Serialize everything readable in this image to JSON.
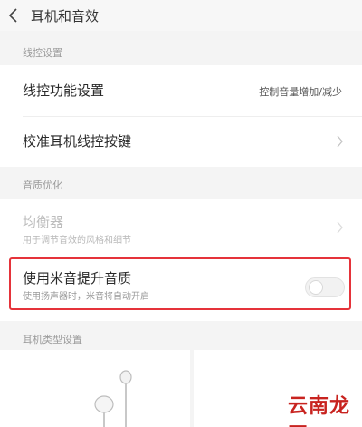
{
  "header": {
    "title": "耳机和音效"
  },
  "wire_control": {
    "section_label": "线控设置",
    "function_setting": {
      "title": "线控功能设置",
      "value": "控制音量增加/减少"
    },
    "calibrate": {
      "title": "校准耳机线控按键"
    }
  },
  "sound_quality": {
    "section_label": "音质优化",
    "equalizer": {
      "title": "均衡器",
      "subtitle": "用于调节音效的风格和细节",
      "enabled": false
    },
    "mi_sound": {
      "title": "使用米音提升音质",
      "subtitle": "使用扬声器时，米音将自动开启",
      "toggle_on": false
    }
  },
  "earphone_type": {
    "section_label": "耳机类型设置"
  },
  "colors": {
    "highlight": "#e5333a",
    "watermark": "#c8231f"
  },
  "watermark": "云南龙网"
}
